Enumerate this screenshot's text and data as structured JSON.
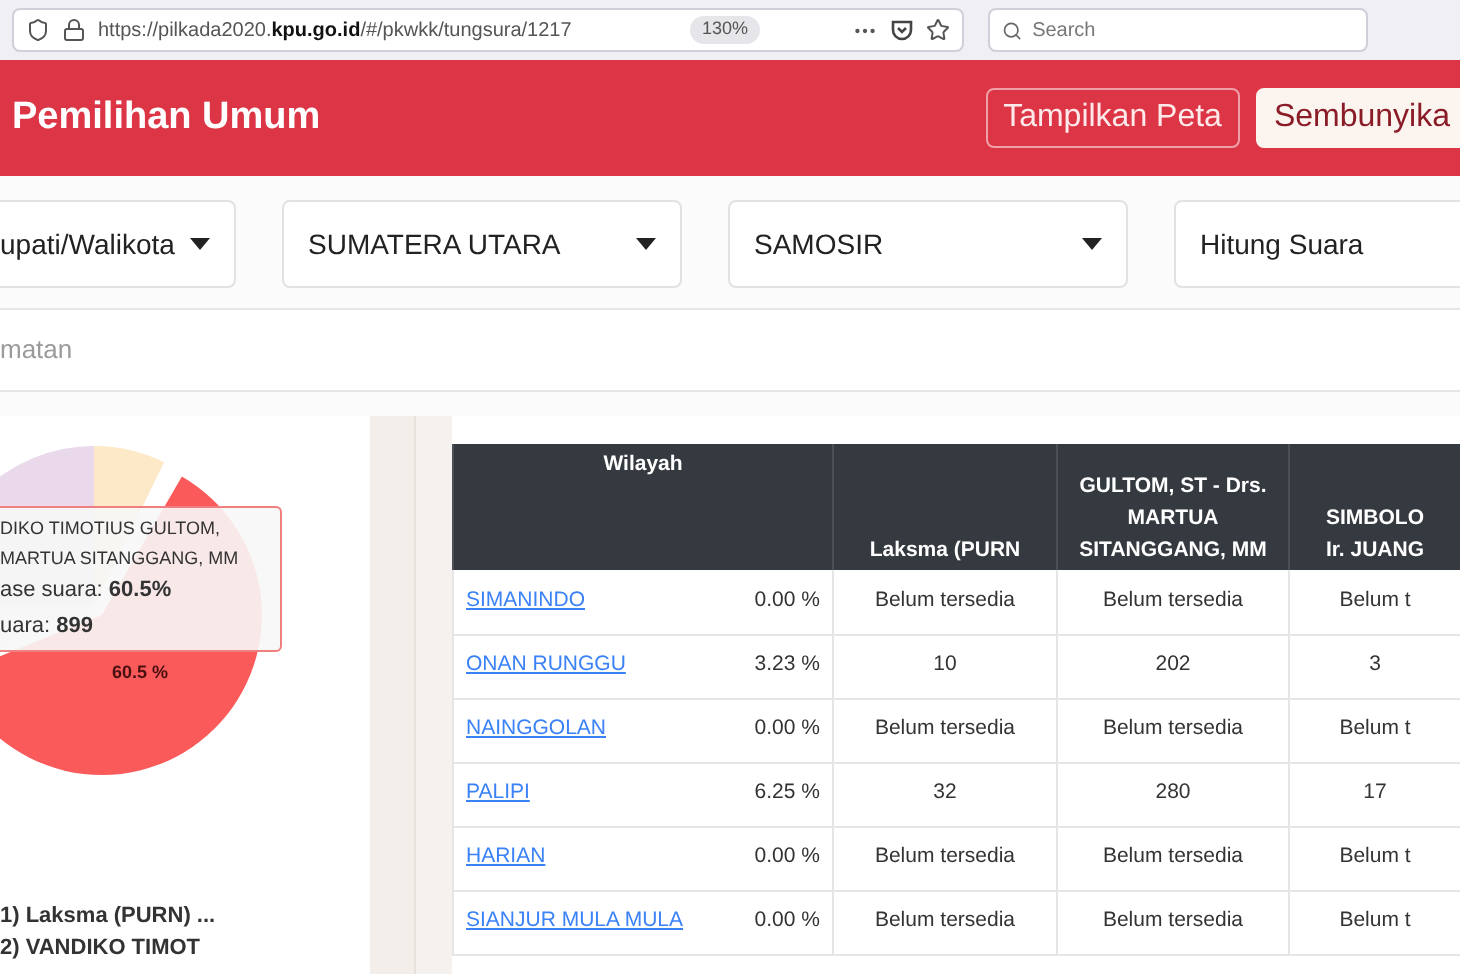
{
  "browser": {
    "url_prefix": "https://pilkada2020.",
    "url_domain": "kpu.go.id",
    "url_path": "/#/pkwkk/tungsura/1217",
    "zoom": "130%",
    "search": {
      "placeholder": "Search"
    }
  },
  "header": {
    "title": "Pemilihan Umum",
    "buttons": [
      {
        "label": "Tampilkan Peta",
        "kind": "outline"
      },
      {
        "label": "Sembunyika",
        "kind": "filled"
      }
    ]
  },
  "filters": [
    {
      "value": "upati/Walikota",
      "kind": "select"
    },
    {
      "value": "SUMATERA UTARA",
      "kind": "select"
    },
    {
      "value": "SAMOSIR",
      "kind": "select"
    },
    {
      "value": "Hitung Suara",
      "kind": "select"
    }
  ],
  "kecamatan_field": {
    "placeholder": "matan"
  },
  "pie": {
    "slice_label": "60.5 %",
    "tooltip": {
      "lines": [
        "DIKO TIMOTIUS GULTOM,",
        "MARTUA SITANGGANG, MM",
        "ase suara: **60.5%**",
        "uara: **899**"
      ]
    },
    "legend": [
      "1) Laksma (PURN) ...",
      "2) VANDIKO TIMOT"
    ]
  },
  "table": {
    "columns": [
      {
        "lines": [
          "Wilayah"
        ]
      },
      {
        "lines": [
          "Laksma (PURN"
        ]
      },
      {
        "lines": [
          "GULTOM, ST - Drs.",
          "MARTUA",
          "SITANGGANG, MM"
        ]
      },
      {
        "lines": [
          "SIMBOLO",
          "Ir. JUANG"
        ]
      }
    ],
    "rows": [
      {
        "cells": [
          {
            "region": "SIMANINDO",
            "percent": "0.00 %"
          },
          {
            "text": "Belum tersedia"
          },
          {
            "text": "Belum tersedia"
          },
          {
            "text": "Belum t"
          }
        ]
      },
      {
        "cells": [
          {
            "region": "ONAN RUNGGU",
            "percent": "3.23 %"
          },
          {
            "text": "10"
          },
          {
            "text": "202"
          },
          {
            "text": "3"
          }
        ]
      },
      {
        "cells": [
          {
            "region": "NAINGGOLAN",
            "percent": "0.00 %"
          },
          {
            "text": "Belum tersedia"
          },
          {
            "text": "Belum tersedia"
          },
          {
            "text": "Belum t"
          }
        ]
      },
      {
        "cells": [
          {
            "region": "PALIPI",
            "percent": "6.25 %"
          },
          {
            "text": "32"
          },
          {
            "text": "280"
          },
          {
            "text": "17"
          }
        ]
      },
      {
        "cells": [
          {
            "region": "HARIAN",
            "percent": "0.00 %"
          },
          {
            "text": "Belum tersedia"
          },
          {
            "text": "Belum tersedia"
          },
          {
            "text": "Belum t"
          }
        ]
      },
      {
        "cells": [
          {
            "region": "SIANJUR MULA MULA",
            "percent": "0.00 %"
          },
          {
            "text": "Belum tersedia"
          },
          {
            "text": "Belum tersedia"
          },
          {
            "text": "Belum t"
          }
        ]
      }
    ]
  }
}
